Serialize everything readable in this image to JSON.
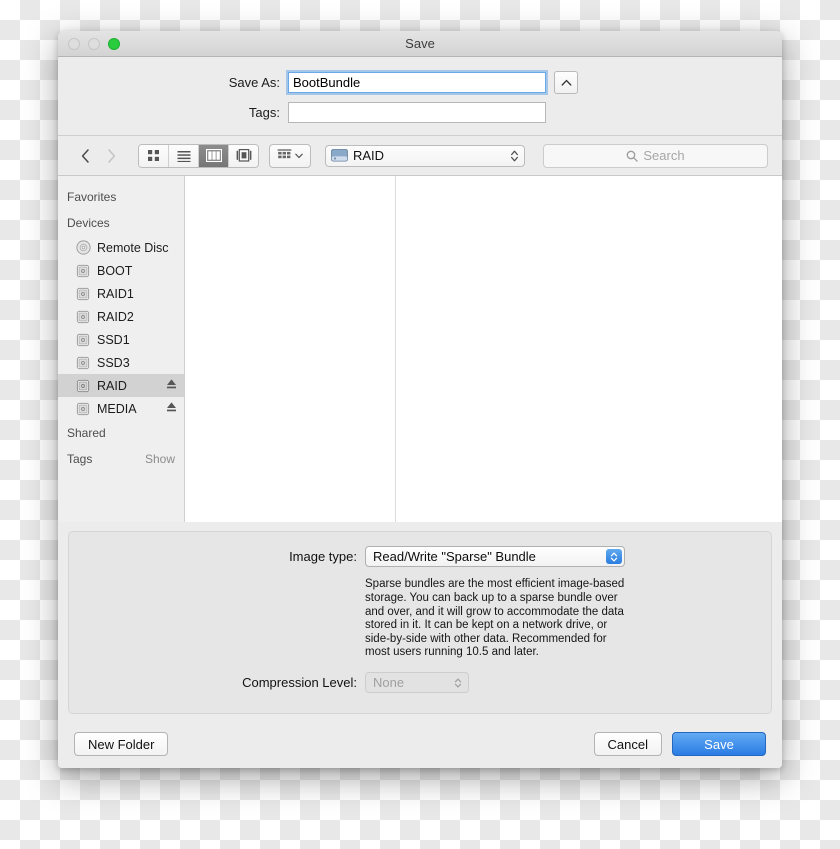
{
  "window": {
    "title": "Save",
    "traffic_lights": [
      "close-button",
      "minimize-button",
      "zoom-button"
    ]
  },
  "form": {
    "save_as_label": "Save As:",
    "save_as_value": "BootBundle",
    "tags_label": "Tags:",
    "tags_value": "",
    "tags_placeholder": "",
    "collapse_icon": "chevron-up-icon"
  },
  "toolbar": {
    "back_icon": "chevron-left-icon",
    "forward_icon": "chevron-right-icon",
    "view_modes": [
      {
        "name": "icon-view",
        "icon": "grid-icon",
        "selected": false
      },
      {
        "name": "list-view",
        "icon": "list-icon",
        "selected": false
      },
      {
        "name": "column-view",
        "icon": "columns-icon",
        "selected": true
      },
      {
        "name": "gallery-view",
        "icon": "gallery-icon",
        "selected": false
      }
    ],
    "arrange_icon": "arrange-icon",
    "arrange_chevron": "chevron-down-icon",
    "path_icon": "hard-drive-icon",
    "path_label": "RAID",
    "path_chevron": "up-down-chevron-icon",
    "search_icon": "search-icon",
    "search_placeholder": "Search",
    "search_value": ""
  },
  "sidebar": {
    "sections": [
      {
        "header": "Favorites",
        "items": []
      },
      {
        "header": "Devices",
        "items": [
          {
            "label": "Remote Disc",
            "icon": "optical-disc-icon",
            "selected": false,
            "eject": false
          },
          {
            "label": "BOOT",
            "icon": "hard-drive-icon",
            "selected": false,
            "eject": false
          },
          {
            "label": "RAID1",
            "icon": "hard-drive-icon",
            "selected": false,
            "eject": false
          },
          {
            "label": "RAID2",
            "icon": "hard-drive-icon",
            "selected": false,
            "eject": false
          },
          {
            "label": "SSD1",
            "icon": "hard-drive-icon",
            "selected": false,
            "eject": false
          },
          {
            "label": "SSD3",
            "icon": "hard-drive-icon",
            "selected": false,
            "eject": false
          },
          {
            "label": "RAID",
            "icon": "hard-drive-icon",
            "selected": true,
            "eject": true
          },
          {
            "label": "MEDIA",
            "icon": "hard-drive-icon",
            "selected": false,
            "eject": true
          }
        ]
      },
      {
        "header": "Shared",
        "items": []
      }
    ],
    "tags_label": "Tags",
    "tags_show": "Show"
  },
  "browser": {
    "columns": [
      {
        "name": "column-1",
        "items": []
      },
      {
        "name": "column-2",
        "items": []
      }
    ]
  },
  "options": {
    "image_type_label": "Image type:",
    "image_type_value": "Read/Write \"Sparse\" Bundle",
    "description": "Sparse bundles are the most efficient image-based storage.  You can back up to a sparse bundle over and over, and it will grow to accommodate the data stored in it. It can be kept on a network drive, or side-by-side with other data. Recommended for most users running 10.5 and later.",
    "compression_label": "Compression Level:",
    "compression_value": "None",
    "compression_disabled": true
  },
  "footer": {
    "new_folder_label": "New Folder",
    "cancel_label": "Cancel",
    "save_label": "Save"
  },
  "colors": {
    "accent_blue": "#2a7ce4",
    "focus_ring": "#6aa8e8",
    "selected_row": "#d2d2d2",
    "window_chrome": "#ececec",
    "zoom_green": "#28cc3d"
  }
}
